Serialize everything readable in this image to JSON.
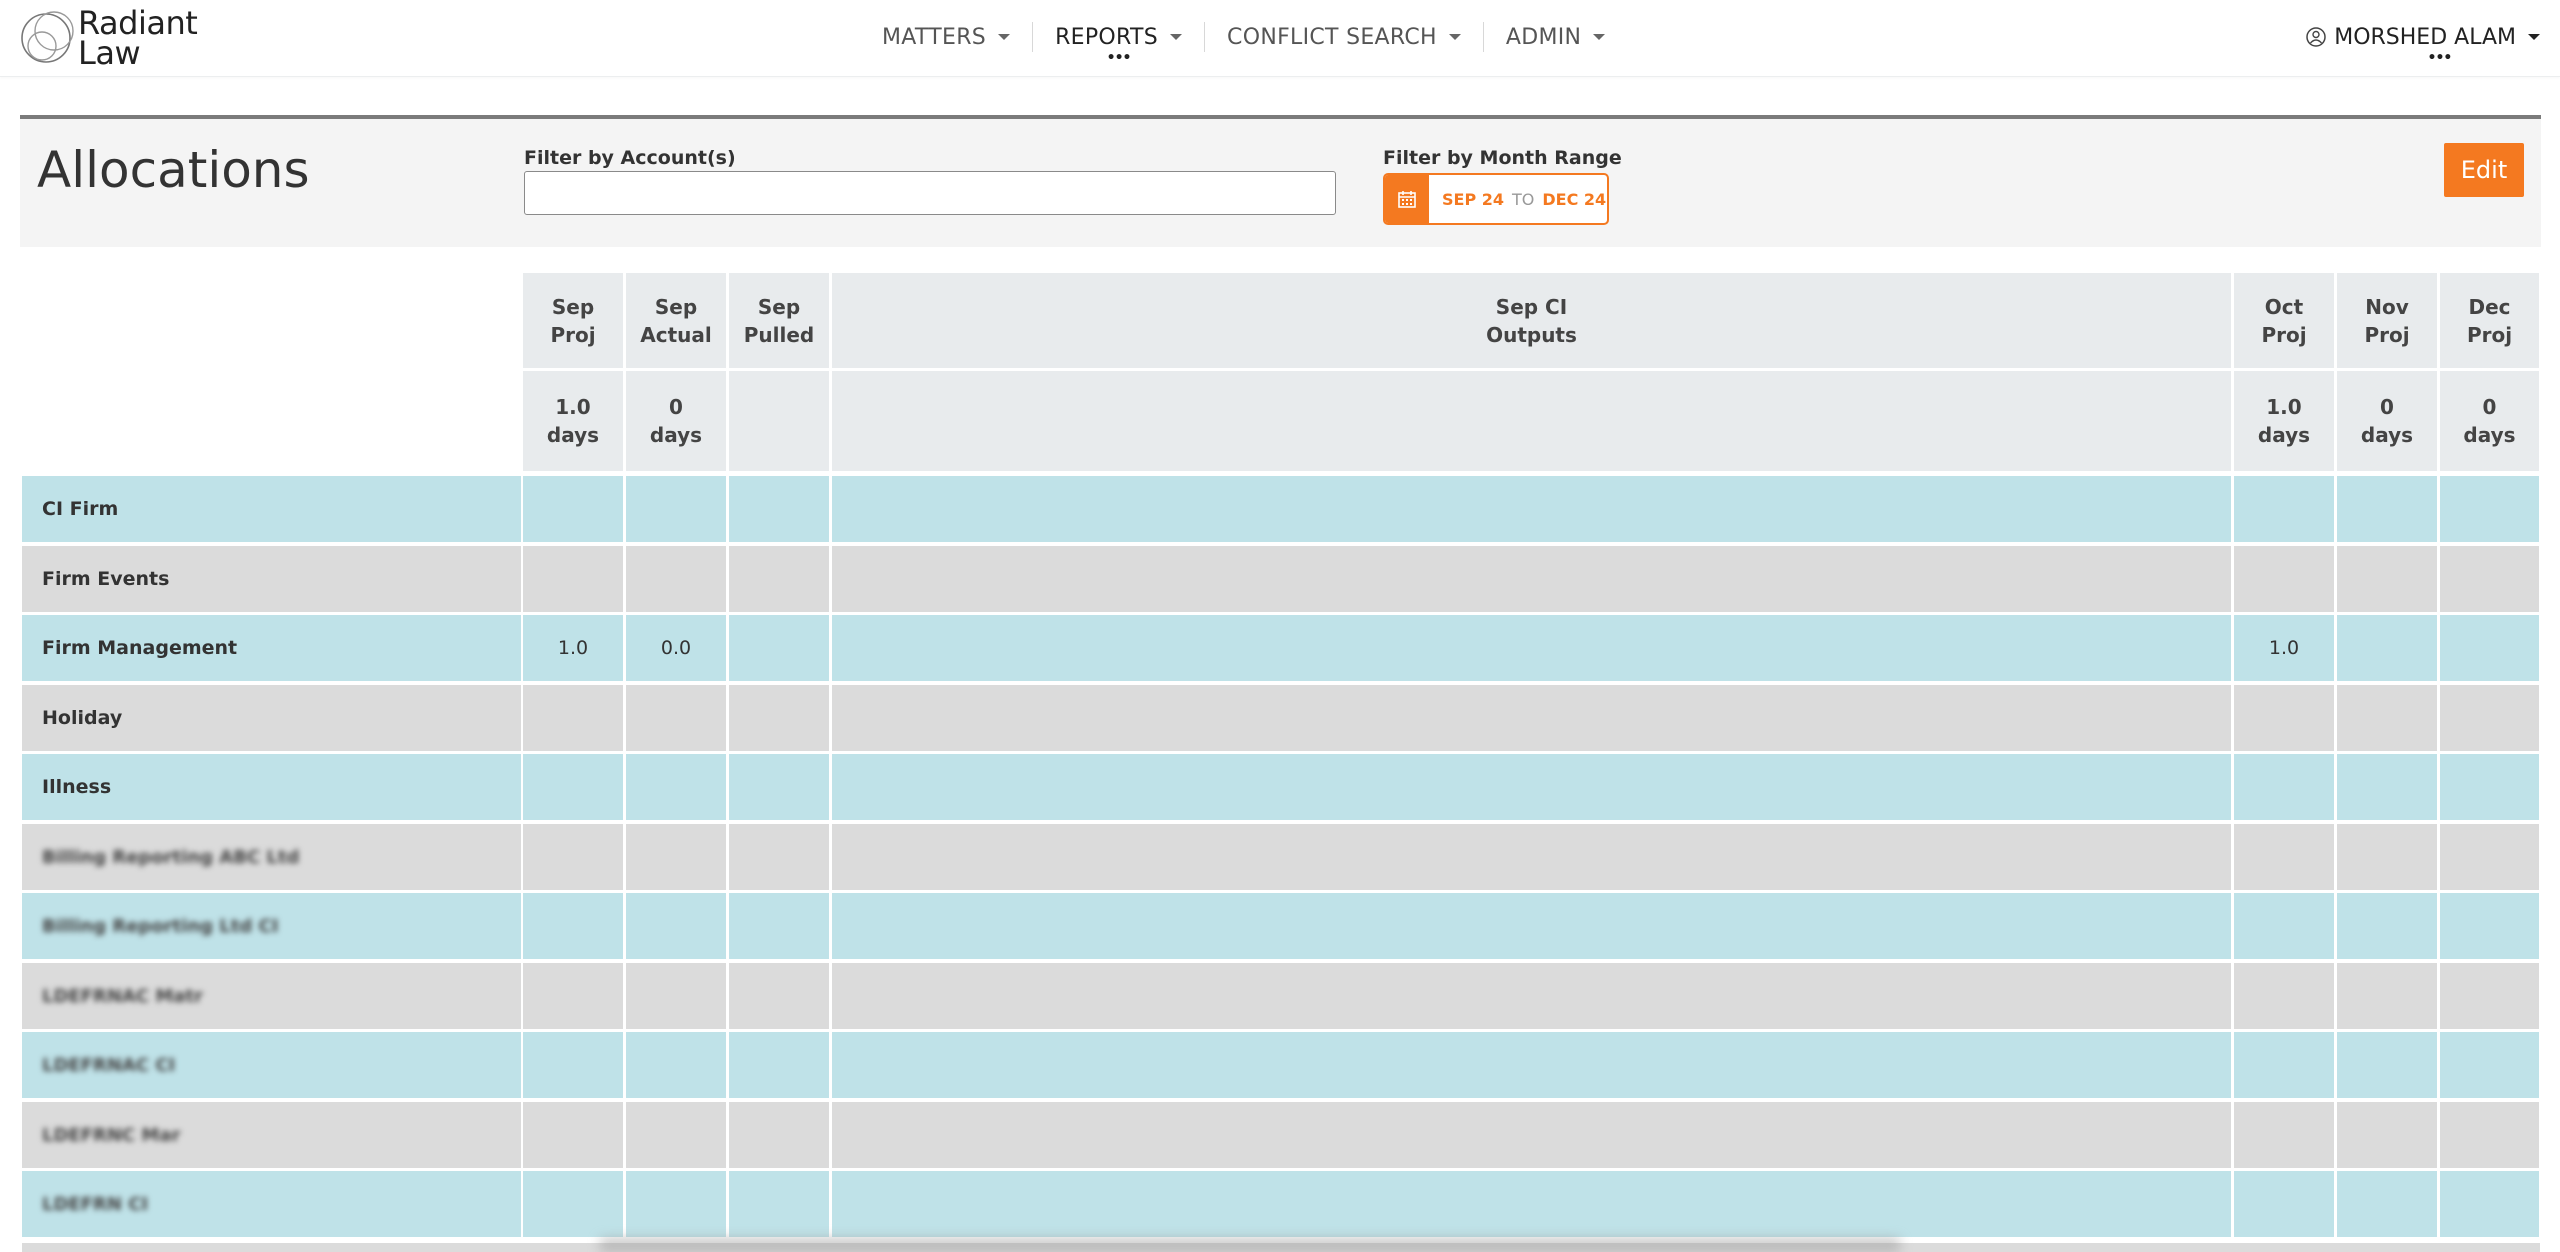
{
  "brand": {
    "line1": "Radiant",
    "line2": "Law"
  },
  "nav": {
    "items": [
      {
        "label": "MATTERS"
      },
      {
        "label": "REPORTS",
        "more": "•••"
      },
      {
        "label": "CONFLICT SEARCH"
      },
      {
        "label": "ADMIN"
      }
    ],
    "user": {
      "name": "MORSHED ALAM",
      "more": "•••"
    }
  },
  "header": {
    "title": "Allocations",
    "account_filter_label": "Filter by Account(s)",
    "account_filter_value": "",
    "month_filter_label": "Filter by Month Range",
    "range_from": "SEP 24",
    "range_sep": "TO",
    "range_to": "DEC 24",
    "edit_label": "Edit"
  },
  "table": {
    "columns": [
      {
        "label": "Sep\nProj",
        "total": "1.0\ndays"
      },
      {
        "label": "Sep\nActual",
        "total": "0\ndays"
      },
      {
        "label": "Sep\nPulled",
        "total": ""
      },
      {
        "label": "Sep CI\nOutputs",
        "total": ""
      },
      {
        "label": "Oct\nProj",
        "total": "1.0\ndays"
      },
      {
        "label": "Nov\nProj",
        "total": "0\ndays"
      },
      {
        "label": "Dec\nProj",
        "total": "0\ndays"
      }
    ],
    "rows": [
      {
        "label": "CI Firm",
        "values": [
          "",
          "",
          "",
          "",
          "",
          "",
          ""
        ]
      },
      {
        "label": "Firm Events",
        "values": [
          "",
          "",
          "",
          "",
          "",
          "",
          ""
        ]
      },
      {
        "label": "Firm Management",
        "values": [
          "1.0",
          "0.0",
          "",
          "",
          "1.0",
          "",
          ""
        ]
      },
      {
        "label": "Holiday",
        "values": [
          "",
          "",
          "",
          "",
          "",
          "",
          ""
        ]
      },
      {
        "label": "Illness",
        "values": [
          "",
          "",
          "",
          "",
          "",
          "",
          ""
        ]
      },
      {
        "label": "Billing Reporting ABC Ltd",
        "values": [
          "",
          "",
          "",
          "",
          "",
          "",
          ""
        ],
        "redacted": true
      },
      {
        "label": "Billing Reporting Ltd CI",
        "values": [
          "",
          "",
          "",
          "",
          "",
          "",
          ""
        ],
        "redacted": true
      },
      {
        "label": "LDEFRNAC Matr",
        "values": [
          "",
          "",
          "",
          "",
          "",
          "",
          ""
        ],
        "redacted": true
      },
      {
        "label": "LDEFRNAC CI",
        "values": [
          "",
          "",
          "",
          "",
          "",
          "",
          ""
        ],
        "redacted": true
      },
      {
        "label": "LDEFRNC Mar",
        "values": [
          "",
          "",
          "",
          "",
          "",
          "",
          ""
        ],
        "redacted": true
      },
      {
        "label": "LDEFRN CI",
        "values": [
          "",
          "",
          "",
          "",
          "",
          "",
          ""
        ],
        "redacted": true
      }
    ]
  },
  "colors": {
    "accent": "#f47920",
    "row_teal": "#bfe2e8",
    "row_grey": "#dbdbdb",
    "header_bg": "#e8ebed"
  }
}
